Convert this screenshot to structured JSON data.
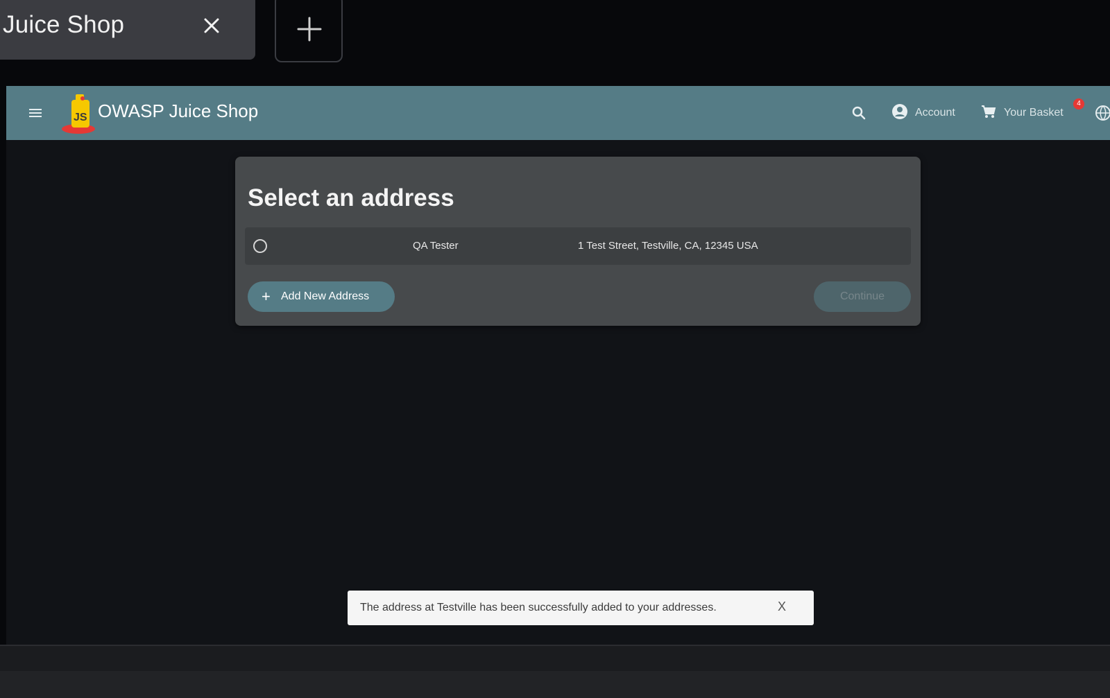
{
  "browser": {
    "tab_title": "Juice Shop",
    "close_icon": "close-icon",
    "new_tab_icon": "plus-icon"
  },
  "toolbar": {
    "app_title": "OWASP Juice Shop",
    "account_label": "Account",
    "basket_label": "Your Basket",
    "basket_count": "4",
    "icons": [
      "menu-icon",
      "juice-shop-logo",
      "search-icon",
      "account-circle-icon",
      "cart-icon",
      "language-icon"
    ],
    "color": "#557c86"
  },
  "card": {
    "title": "Select an address",
    "addresses": [
      {
        "name": "QA Tester",
        "address": "1 Test Street, Testville, CA, 12345  USA",
        "selected": false
      }
    ],
    "add_button_label": "Add New Address",
    "continue_button_label": "Continue"
  },
  "snackbar": {
    "message": "The address at Testville has been successfully added to your addresses.",
    "close_label": "X"
  }
}
